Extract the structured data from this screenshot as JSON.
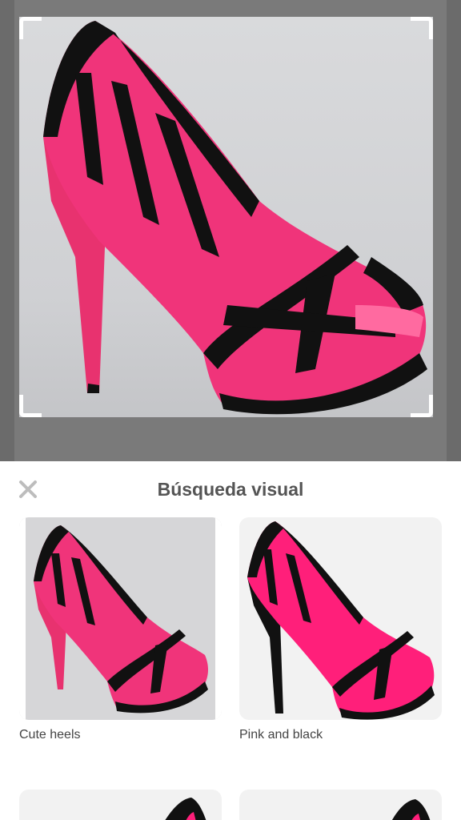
{
  "sheet": {
    "title": "Búsqueda visual",
    "close_icon": "close-icon"
  },
  "results": [
    {
      "label": "Cute heels",
      "image": "pink-black-heel"
    },
    {
      "label": "Pink and black",
      "image": "pink-black-heel-white-bg"
    },
    {
      "label": "",
      "image": "heel-partial"
    },
    {
      "label": "",
      "image": "heel-partial"
    }
  ],
  "colors": {
    "shoe_pink": "#f0347a",
    "shoe_black": "#111111",
    "sheet_background": "#ffffff",
    "title_text": "#555555"
  }
}
